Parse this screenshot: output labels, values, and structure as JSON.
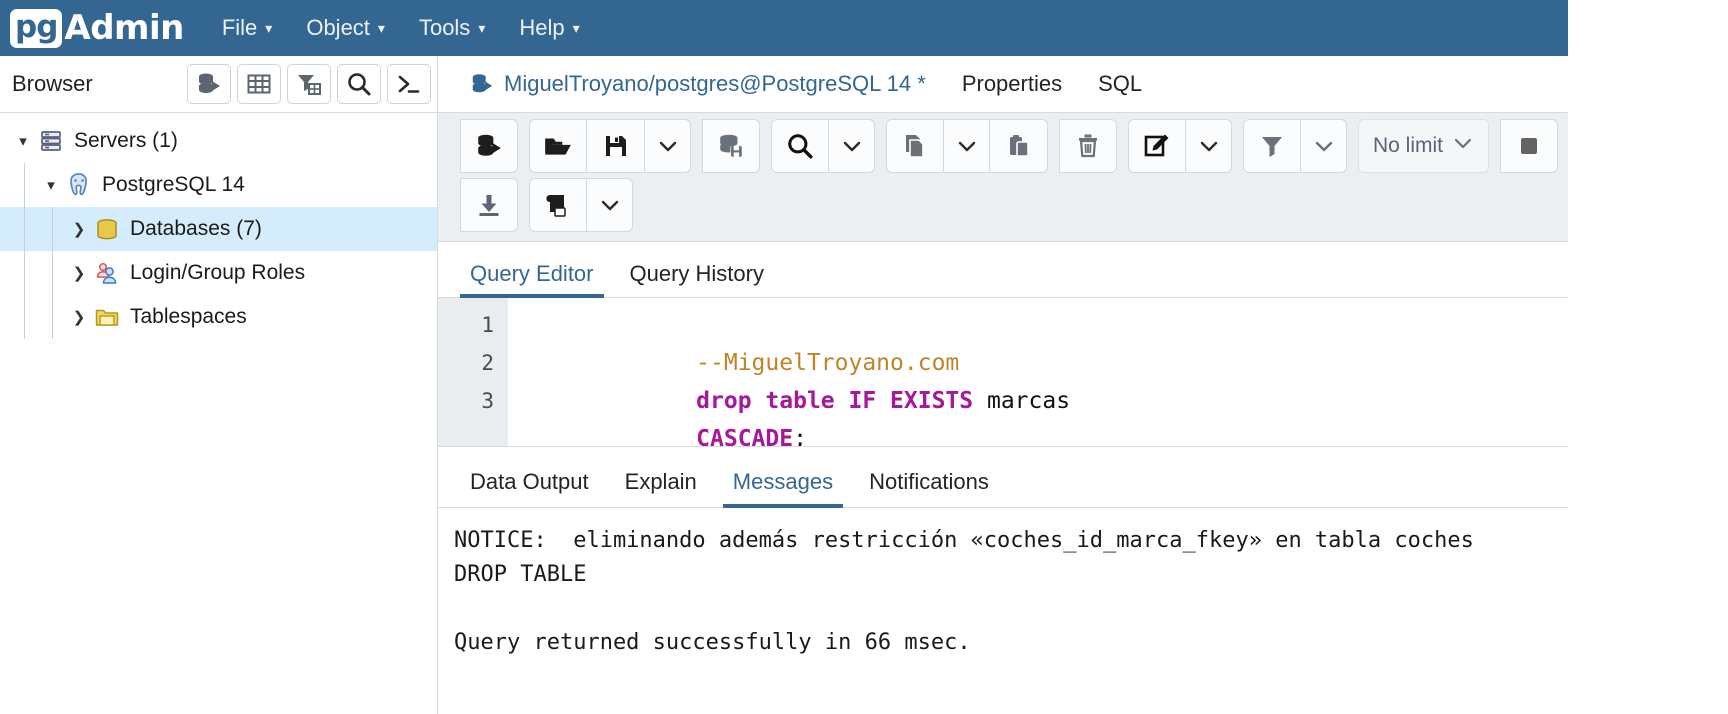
{
  "app": {
    "brand_pg": "pg",
    "brand_admin": "Admin",
    "accent": "#336791",
    "menu": [
      {
        "label": "File",
        "caret": "chevron-down-icon"
      },
      {
        "label": "Object",
        "caret": "chevron-down-icon"
      },
      {
        "label": "Tools",
        "caret": "chevron-down-icon"
      },
      {
        "label": "Help",
        "caret": "chevron-down-icon"
      }
    ]
  },
  "browser": {
    "title": "Browser",
    "tools": [
      {
        "name": "query-tool-icon"
      },
      {
        "name": "view-data-icon"
      },
      {
        "name": "filtered-rows-icon"
      },
      {
        "name": "search-icon"
      },
      {
        "name": "psql-terminal-icon"
      }
    ],
    "tree": [
      {
        "label": "Servers (1)",
        "twisty": "expanded",
        "icon": "servers-icon",
        "depth": 0,
        "selected": false
      },
      {
        "label": "PostgreSQL 14",
        "twisty": "expanded",
        "icon": "postgres-icon",
        "depth": 1,
        "selected": false
      },
      {
        "label": "Databases (7)",
        "twisty": "collapsed",
        "icon": "databases-icon",
        "depth": 2,
        "selected": true
      },
      {
        "label": "Login/Group Roles",
        "twisty": "collapsed",
        "icon": "roles-icon",
        "depth": 2,
        "selected": false
      },
      {
        "label": "Tablespaces",
        "twisty": "collapsed",
        "icon": "tablespaces-icon",
        "depth": 2,
        "selected": false
      }
    ]
  },
  "query_tool": {
    "tabs": [
      {
        "label": "MiguelTroyano/postgres@PostgreSQL 14 *",
        "icon": "query-tool-icon",
        "active": true
      },
      {
        "label": "Properties",
        "active": false
      },
      {
        "label": "SQL",
        "active": false
      }
    ],
    "toolbar": {
      "row1": [
        {
          "group": [
            {
              "name": "open-query-tool-icon",
              "type": "icon"
            }
          ]
        },
        {
          "group": [
            {
              "name": "open-file-icon",
              "type": "icon"
            },
            {
              "name": "save-file-icon",
              "type": "icon"
            },
            {
              "name": "chevron-down-icon",
              "type": "caret"
            }
          ]
        },
        {
          "group": [
            {
              "name": "execute-script-icon",
              "type": "icon"
            }
          ]
        },
        {
          "group": [
            {
              "name": "search-icon",
              "type": "icon"
            },
            {
              "name": "chevron-down-icon",
              "type": "caret"
            }
          ]
        },
        {
          "group": [
            {
              "name": "copy-icon",
              "type": "icon"
            },
            {
              "name": "chevron-down-icon",
              "type": "caret"
            },
            {
              "name": "paste-icon",
              "type": "icon"
            }
          ]
        },
        {
          "group": [
            {
              "name": "delete-icon",
              "type": "icon"
            }
          ]
        },
        {
          "group": [
            {
              "name": "edit-icon",
              "type": "icon"
            },
            {
              "name": "chevron-down-icon",
              "type": "caret"
            }
          ]
        },
        {
          "group": [
            {
              "name": "filter-icon",
              "type": "icon"
            },
            {
              "name": "chevron-down-icon",
              "type": "caret"
            }
          ]
        }
      ],
      "row2": [
        {
          "group": [
            {
              "name": "download-icon",
              "type": "icon"
            }
          ]
        },
        {
          "group": [
            {
              "name": "macros-icon",
              "type": "icon"
            },
            {
              "name": "chevron-down-icon",
              "type": "caret"
            }
          ]
        }
      ],
      "row_limit_label": "No limit",
      "row_limit_caret": "chevron-down-icon",
      "stop_button": "stop-icon"
    },
    "editor_tabs": [
      {
        "label": "Query Editor",
        "active": true
      },
      {
        "label": "Query History",
        "active": false
      }
    ],
    "editor": {
      "lines": [
        {
          "num": "1",
          "tokens": [
            {
              "t": "--MiguelTroyano.com",
              "c": "comment"
            }
          ]
        },
        {
          "num": "2",
          "tokens": [
            {
              "t": "drop table IF EXISTS ",
              "c": "kw"
            },
            {
              "t": "marcas",
              "c": "plain"
            }
          ]
        },
        {
          "num": "3",
          "tokens": [
            {
              "t": "CASCADE",
              "c": "kw"
            },
            {
              "t": ";",
              "c": "plain"
            }
          ]
        }
      ]
    },
    "result_tabs": [
      {
        "label": "Data Output",
        "active": false
      },
      {
        "label": "Explain",
        "active": false
      },
      {
        "label": "Messages",
        "active": true
      },
      {
        "label": "Notifications",
        "active": false
      }
    ],
    "messages": "NOTICE:  eliminando además restricción «coches_id_marca_fkey» en tabla coches\nDROP TABLE\n\nQuery returned successfully in 66 msec."
  }
}
